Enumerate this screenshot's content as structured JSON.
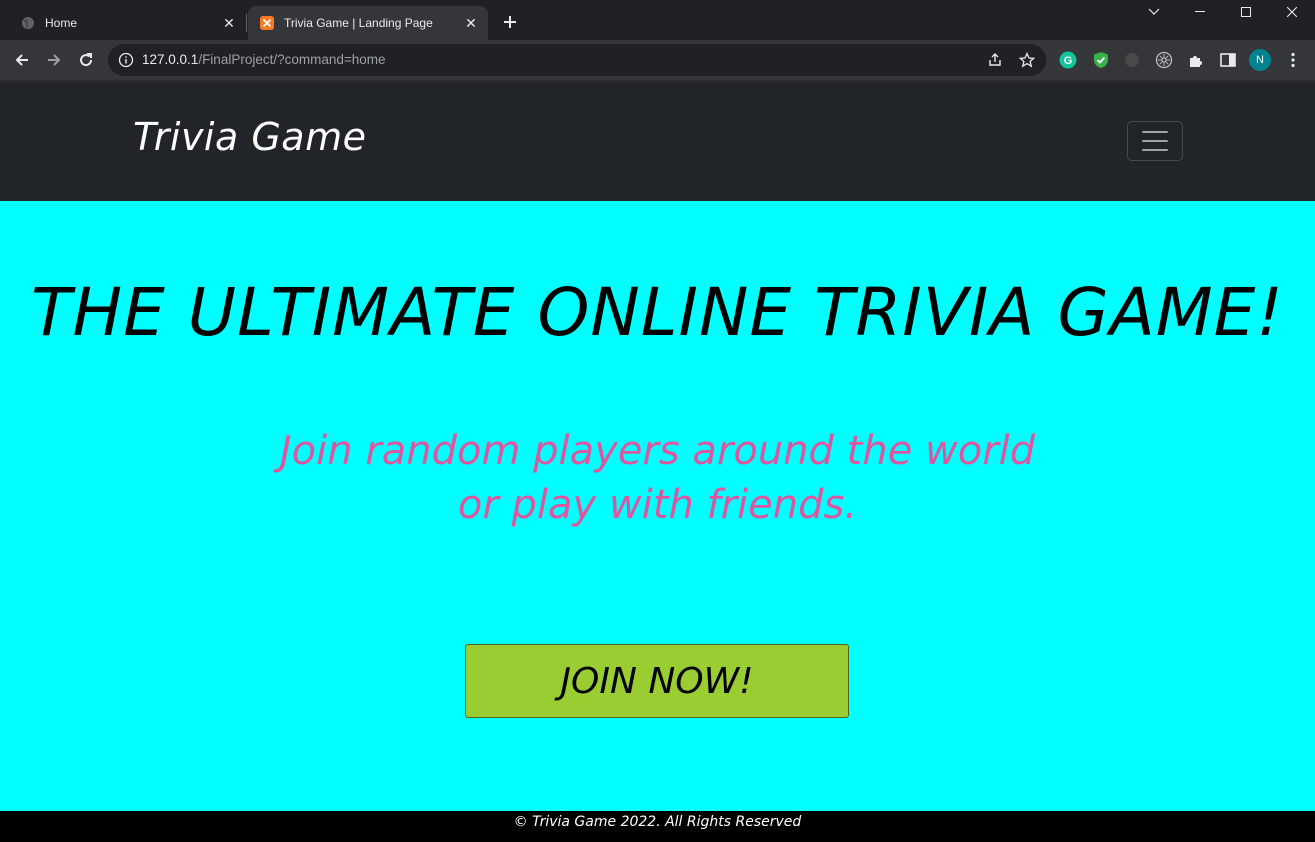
{
  "browser": {
    "tabs": [
      {
        "title": "Home",
        "active": false
      },
      {
        "title": "Trivia Game | Landing Page",
        "active": true
      }
    ],
    "url": {
      "host": "127.0.0.1",
      "path": "/FinalProject/?command=home"
    },
    "profile_initial": "N"
  },
  "page": {
    "navbar": {
      "brand": "Trivia Game"
    },
    "hero": {
      "headline": "THE ULTIMATE ONLINE TRIVIA GAME!",
      "subtitle_line1": "Join random players around the world",
      "subtitle_line2": "or play with friends.",
      "cta_label": "JOIN NOW!"
    },
    "footer": {
      "text": "© Trivia Game 2022. All Rights Reserved"
    }
  },
  "colors": {
    "page_background": "#00ffff",
    "navbar_background": "#212529",
    "subtitle": "#e0559f",
    "cta_background": "#9acd32",
    "footer_background": "#000000"
  },
  "icons": {
    "tab1": "globe-icon",
    "tab2": "xampp-icon",
    "toolbar": [
      "back-arrow-icon",
      "forward-arrow-icon",
      "reload-icon",
      "info-icon",
      "share-icon",
      "star-icon"
    ],
    "extensions": [
      "grammarly-icon",
      "shield-check-icon",
      "extension-dot-icon",
      "cog-extension-icon",
      "puzzle-icon",
      "sidepanel-icon",
      "kebab-menu-icon"
    ]
  }
}
